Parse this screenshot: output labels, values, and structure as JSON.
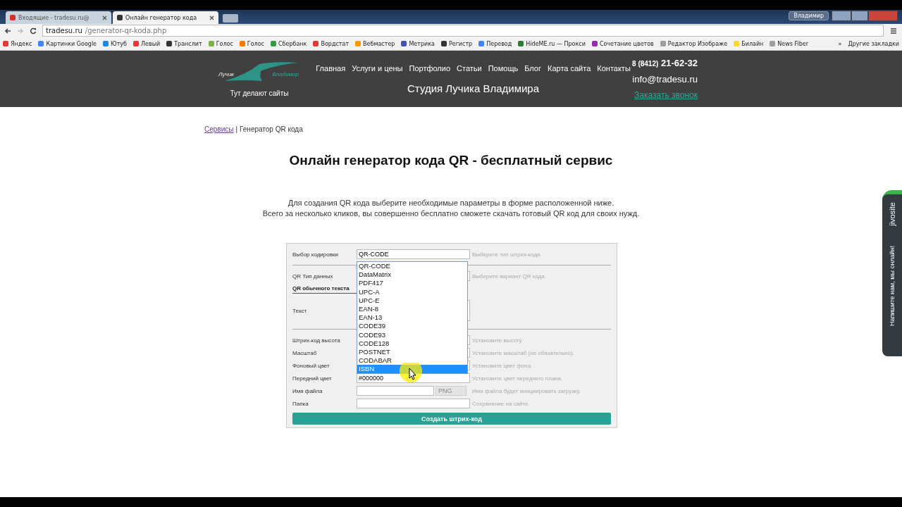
{
  "browser": {
    "tabs": [
      {
        "title": "Входящие - tradesu.ru@",
        "selected": false,
        "kind": "mail"
      },
      {
        "title": "Онлайн генератор кода",
        "selected": true,
        "kind": "site"
      }
    ],
    "user": "Владимир",
    "url": {
      "host": "tradesu.ru",
      "path": "/generator-qr-koda.php"
    },
    "bookmarks": [
      {
        "label": "Яндекс",
        "color": "#e53935"
      },
      {
        "label": "Картинки Google",
        "color": "#4285f4"
      },
      {
        "label": "Ютуб",
        "color": "#1e88e5"
      },
      {
        "label": "Левый",
        "color": "#e53935"
      },
      {
        "label": "Транслит",
        "color": "#333333"
      },
      {
        "label": "Голос",
        "color": "#7cb342"
      },
      {
        "label": "Голос",
        "color": "#f57c00"
      },
      {
        "label": "Сбербанк",
        "color": "#2e9e3e"
      },
      {
        "label": "Вордстат",
        "color": "#e53935"
      },
      {
        "label": "Вебмастер",
        "color": "#ff9800"
      },
      {
        "label": "Метрика",
        "color": "#3f51b5"
      },
      {
        "label": "Регистр",
        "color": "#333333"
      },
      {
        "label": "Перевод",
        "color": "#4285f4"
      },
      {
        "label": "HideME.ru — Прокси",
        "color": "#2e7d32"
      },
      {
        "label": "Сочетание цветов",
        "color": "#9c27b0"
      },
      {
        "label": "Редактор Изображе",
        "color": "#9e9e9e"
      },
      {
        "label": "Билайн",
        "color": "#fdd835"
      },
      {
        "label": "News Fiber",
        "color": "#9e9e9e"
      }
    ],
    "bookmarks_more": "»",
    "other_bookmarks": "Другие закладки"
  },
  "header": {
    "logo": {
      "left": "Лучик",
      "right": "Владимир"
    },
    "tagline": "Тут делают сайты",
    "nav": [
      "Главная",
      "Услуги и цены",
      "Портфолио",
      "Статьи",
      "Помощь",
      "Блог",
      "Карта сайта",
      "Контакты"
    ],
    "studio": "Студия Лучика Владимира",
    "phone_code": "8 (8412)",
    "phone": "21-62-32",
    "email": "info@tradesu.ru",
    "callback": "Заказать звонок"
  },
  "breadcrumb": {
    "link": "Сервисы",
    "separator": "|",
    "current": "Генератор QR кода"
  },
  "title": "Онлайн генератор кода QR - бесплатный сервис",
  "intro": [
    "Для создания QR кода выберите необходимые параметры в форме расположенной ниже.",
    "Всего за несколько кликов, вы совершенно бесплатно сможете скачать готовый QR код для своих нужд."
  ],
  "form": {
    "rows": [
      {
        "kind": "select",
        "label": "Выбор кодировки",
        "value": "QR-CODE",
        "hint": "Выберите тип штрих-кода."
      },
      {
        "kind": "rule"
      },
      {
        "kind": "select",
        "label": "QR Тип данных",
        "hint": "Выберите вариант QR кода."
      },
      {
        "kind": "section",
        "label": "QR обычного текста"
      },
      {
        "kind": "textarea",
        "label": "Текст"
      },
      {
        "kind": "rule"
      },
      {
        "kind": "input",
        "label": "Штрих-код высота",
        "hint": "Установите высоту"
      },
      {
        "kind": "input",
        "label": "Масштаб",
        "hint": "Установите масштаб (не обязательно)."
      },
      {
        "kind": "input",
        "label": "Фоновый цвет",
        "hint": "Установите цвет фона."
      },
      {
        "kind": "input",
        "label": "Передний цвет",
        "value": "#000000",
        "hint": "Установите цвет переднего плана."
      },
      {
        "kind": "file",
        "label": "Имя файла",
        "suffix": "PNG",
        "hint": "Имя файла будет инициировать загрузку."
      },
      {
        "kind": "input",
        "label": "Папка",
        "hint": "Сохранение на сайте."
      }
    ],
    "dropdown": [
      {
        "label": "QR-CODE",
        "selected": false
      },
      {
        "label": "DataMatrix",
        "selected": false
      },
      {
        "label": "PDF417",
        "selected": false
      },
      {
        "label": "UPC-A",
        "selected": false
      },
      {
        "label": "UPC-E",
        "selected": false
      },
      {
        "label": "EAN-8",
        "selected": false
      },
      {
        "label": "EAN-13",
        "selected": false
      },
      {
        "label": "CODE39",
        "selected": false
      },
      {
        "label": "CODE93",
        "selected": false
      },
      {
        "label": "CODE128",
        "selected": false
      },
      {
        "label": "POSTNET",
        "selected": false
      },
      {
        "label": "CODABAR",
        "selected": false
      },
      {
        "label": "ISBN",
        "selected": true
      }
    ],
    "submit": "Создать штрих-код"
  },
  "chat": {
    "brand": "jivosite",
    "text": "Напишите нам, мы онлайн!"
  }
}
